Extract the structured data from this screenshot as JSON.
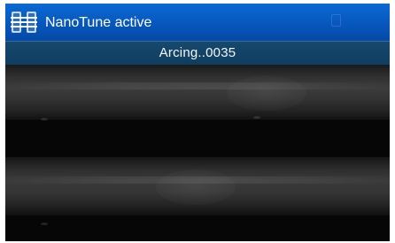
{
  "header": {
    "title": "NanoTune active",
    "icon": "fiber-splice-app-icon"
  },
  "status": {
    "message": "Arcing..0035"
  },
  "colors": {
    "header_blue": "#0757bd",
    "status_bar": "#0f3d60",
    "viewport_bg": "#060606"
  }
}
